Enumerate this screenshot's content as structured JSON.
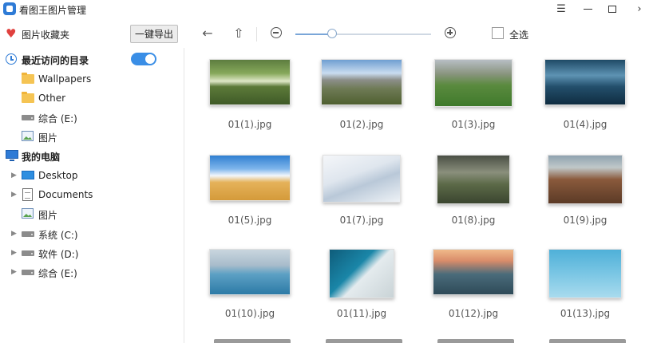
{
  "window": {
    "title": "看图王图片管理",
    "menu_icon": "hamburger-icon",
    "minimize_icon": "minimize-icon",
    "maximize_icon": "maximize-icon",
    "close_glyph": "›"
  },
  "toolbar": {
    "favorites_label": "图片收藏夹",
    "export_label": "一键导出",
    "back_glyph": "←",
    "up_glyph": "⇧",
    "zoom_level": 0.27,
    "select_all_label": "全选"
  },
  "sidebar": {
    "recent_label": "最近访问的目录",
    "recent_toggle_on": true,
    "recent_items": [
      {
        "label": "Wallpapers",
        "icon": "folder-icon"
      },
      {
        "label": "Other",
        "icon": "folder-icon"
      },
      {
        "label": "综合 (E:)",
        "icon": "drive-icon"
      },
      {
        "label": "图片",
        "icon": "picture-icon"
      }
    ],
    "computer_label": "我的电脑",
    "computer_items": [
      {
        "label": "Desktop",
        "icon": "desktop-icon",
        "expandable": true
      },
      {
        "label": "Documents",
        "icon": "document-icon",
        "expandable": true
      },
      {
        "label": "图片",
        "icon": "picture-icon",
        "expandable": false
      },
      {
        "label": "系统 (C:)",
        "icon": "drive-icon",
        "expandable": true
      },
      {
        "label": "软件 (D:)",
        "icon": "drive-icon",
        "expandable": true
      },
      {
        "label": "综合 (E:)",
        "icon": "drive-icon",
        "expandable": true
      }
    ]
  },
  "gallery": {
    "images": [
      {
        "name": "01(1).jpg"
      },
      {
        "name": "01(2).jpg"
      },
      {
        "name": "01(3).jpg"
      },
      {
        "name": "01(4).jpg"
      },
      {
        "name": "01(5).jpg"
      },
      {
        "name": "01(7).jpg"
      },
      {
        "name": "01(8).jpg"
      },
      {
        "name": "01(9).jpg"
      },
      {
        "name": "01(10).jpg"
      },
      {
        "name": "01(11).jpg"
      },
      {
        "name": "01(12).jpg"
      },
      {
        "name": "01(13).jpg"
      }
    ]
  },
  "colors": {
    "accent": "#2e7bd6",
    "toggle": "#3a8ee6",
    "heart": "#e0413e",
    "folder": "#f5c453"
  }
}
